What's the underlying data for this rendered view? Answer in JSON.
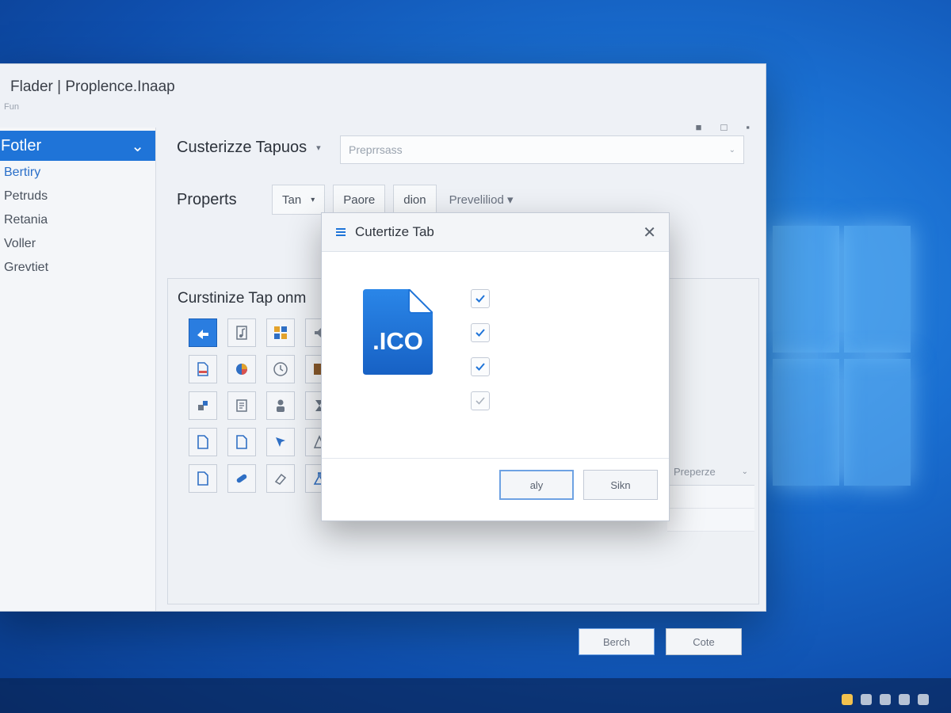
{
  "window": {
    "title": "Flader | Proplence.Inaap",
    "subtitle": "Fun"
  },
  "sidebar": {
    "header_label": "Fotler",
    "items": [
      {
        "label": "Bertiry"
      },
      {
        "label": "Petruds"
      },
      {
        "label": "Retania"
      },
      {
        "label": "Voller"
      },
      {
        "label": "Grevtiet"
      }
    ]
  },
  "content": {
    "row1_label": "Custerizze Tapuos",
    "search_placeholder": "Preprrsass",
    "row2_label": "Properts",
    "control_tab": "Tan",
    "control_patre": "Paore",
    "control_dion": "dion",
    "control_prevaliliod": "Preveliliod",
    "group_title": "Curstinize Tap onm",
    "right_dropdown": "Preperze",
    "buttons": {
      "primary": "Berch",
      "secondary": "Cote"
    }
  },
  "dialog": {
    "title": "Cutertize Tab",
    "file_badge": ".ICO",
    "checkboxes": [
      {
        "checked": true
      },
      {
        "checked": true
      },
      {
        "checked": true
      },
      {
        "checked": false
      }
    ],
    "buttons": {
      "primary": "aly",
      "secondary": "Sikn"
    }
  },
  "colors": {
    "accent": "#1f74d8",
    "ico_file": "#1e6fd1"
  }
}
